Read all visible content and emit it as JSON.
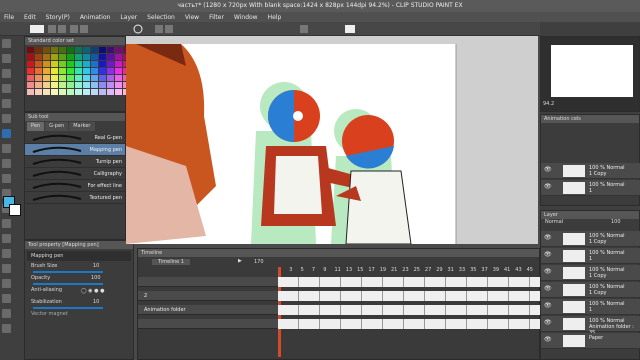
{
  "window": {
    "title": "частьт* (1280 x 720px With blank space:1424 x 828px 144dpi 94.2%) - CLIP STUDIO PAINT EX"
  },
  "menu": [
    "File",
    "Edit",
    "Story(P)",
    "Animation",
    "Layer",
    "Selection",
    "View",
    "Filter",
    "Window",
    "Help"
  ],
  "color_set": {
    "title": "Standard color set"
  },
  "subtool": {
    "tabs": [
      "Pen",
      "G-pen",
      "Marker"
    ],
    "brushes": [
      "Real G-pen",
      "Mapping pen",
      "Turnip pen",
      "Calligraphy",
      "For effect line",
      "Textured pen"
    ],
    "selected": "Mapping pen"
  },
  "tool_property": {
    "title": "Tool property [Mapping pen]",
    "tool_name": "Mapping pen",
    "brush_size_label": "Brush Size",
    "brush_size": "10",
    "opacity_label": "Opacity",
    "opacity": "100",
    "antialiasing_label": "Anti-aliasing",
    "stabilization_label": "Stabilization",
    "stabilization": "10",
    "vector_magnet_label": "Vector magnet"
  },
  "timeline": {
    "tab": "Timeline",
    "name": "Timeline 1",
    "frame_count": "170",
    "frame_numbers": [
      "1",
      "3",
      "5",
      "7",
      "9",
      "11",
      "13",
      "15",
      "17",
      "19",
      "21",
      "23",
      "25",
      "27",
      "29",
      "31",
      "33",
      "35",
      "37",
      "39",
      "41",
      "43",
      "45"
    ],
    "tracks": [
      "",
      "2",
      "Animation folder",
      ""
    ]
  },
  "navigator": {
    "zoom": "94.2"
  },
  "layers": {
    "title": "Layer",
    "blend": "Normal",
    "opacity": "100",
    "items": [
      {
        "a": "100 % Normal",
        "b": "1 Copy"
      },
      {
        "a": "100 % Normal",
        "b": "1"
      },
      {
        "a": "100 % Normal",
        "b": "1 Copy"
      },
      {
        "a": "100 % Normal",
        "b": "1 Copy"
      },
      {
        "a": "100 % Normal",
        "b": "1"
      },
      {
        "a": "100 % Normal",
        "b": "Animation folder : 35"
      },
      {
        "a": "",
        "b": "Paper"
      }
    ]
  },
  "animation_cels": {
    "title": "Animation cels",
    "items": [
      {
        "a": "100 % Normal",
        "b": "1 Copy"
      },
      {
        "a": "100 % Normal",
        "b": "1"
      }
    ]
  },
  "colors": {
    "accent": "#1e78c8",
    "skin": "#b8371f",
    "ball_blue": "#2a7fd4",
    "ball_red": "#d8401e",
    "shadow_green": "#88d69a",
    "timeline_red": "#d44a2a",
    "main_color": "#49b6e8"
  }
}
